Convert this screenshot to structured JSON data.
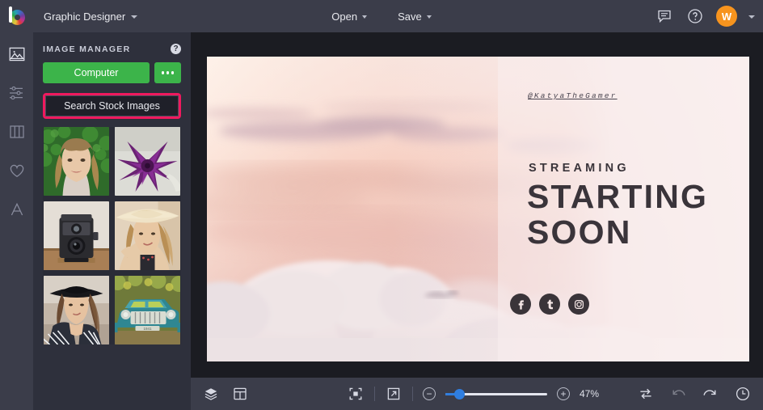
{
  "topbar": {
    "logo_icon": "bestudio-logo-icon",
    "document_title": "Graphic Designer",
    "open_label": "Open",
    "save_label": "Save",
    "chat_icon": "chat-bubble-icon",
    "help_icon": "help-circle-icon",
    "avatar_initial": "W"
  },
  "rail": {
    "items": [
      {
        "icon": "image-icon",
        "name": "sidebar-item-images",
        "active": true
      },
      {
        "icon": "sliders-icon",
        "name": "sidebar-item-adjust",
        "active": false
      },
      {
        "icon": "columns-icon",
        "name": "sidebar-item-collage",
        "active": false
      },
      {
        "icon": "heart-icon",
        "name": "sidebar-item-graphics",
        "active": false
      },
      {
        "icon": "text-a-icon",
        "name": "sidebar-item-text",
        "active": false
      }
    ]
  },
  "panel": {
    "title": "IMAGE MANAGER",
    "help_icon": "help-circle-icon",
    "computer_label": "Computer",
    "more_icon": "ellipsis-icon",
    "search_stock_label": "Search Stock Images",
    "highlight_color": "#f0195e",
    "green_color": "#3cb44a",
    "thumbnails": [
      {
        "name": "thumbnail-woman-smiling-hedge"
      },
      {
        "name": "thumbnail-purple-flower"
      },
      {
        "name": "thumbnail-vintage-camera"
      },
      {
        "name": "thumbnail-woman-straw-hat"
      },
      {
        "name": "thumbnail-woman-black-hat"
      },
      {
        "name": "thumbnail-teal-vintage-truck"
      }
    ]
  },
  "artboard": {
    "handle": "@KatyaTheGamer",
    "eyebrow": "STREAMING",
    "headline_line1": "STARTING",
    "headline_line2": "SOON",
    "socials": [
      {
        "name": "facebook-icon",
        "glyph": "f"
      },
      {
        "name": "tumblr-icon",
        "glyph": "t"
      },
      {
        "name": "instagram-icon",
        "glyph": ""
      }
    ]
  },
  "bottombar": {
    "layers_icon": "layers-icon",
    "template_icon": "template-layout-icon",
    "fit_icon": "fit-to-screen-icon",
    "expand_icon": "expand-arrow-icon",
    "zoom_out_label": "−",
    "zoom_in_label": "+",
    "zoom_level": "47%",
    "slider_percent": 14,
    "compare_icon": "swap-arrows-icon",
    "undo_icon": "undo-arrow-icon",
    "redo_icon": "redo-arrow-icon",
    "history_icon": "history-clock-icon"
  }
}
